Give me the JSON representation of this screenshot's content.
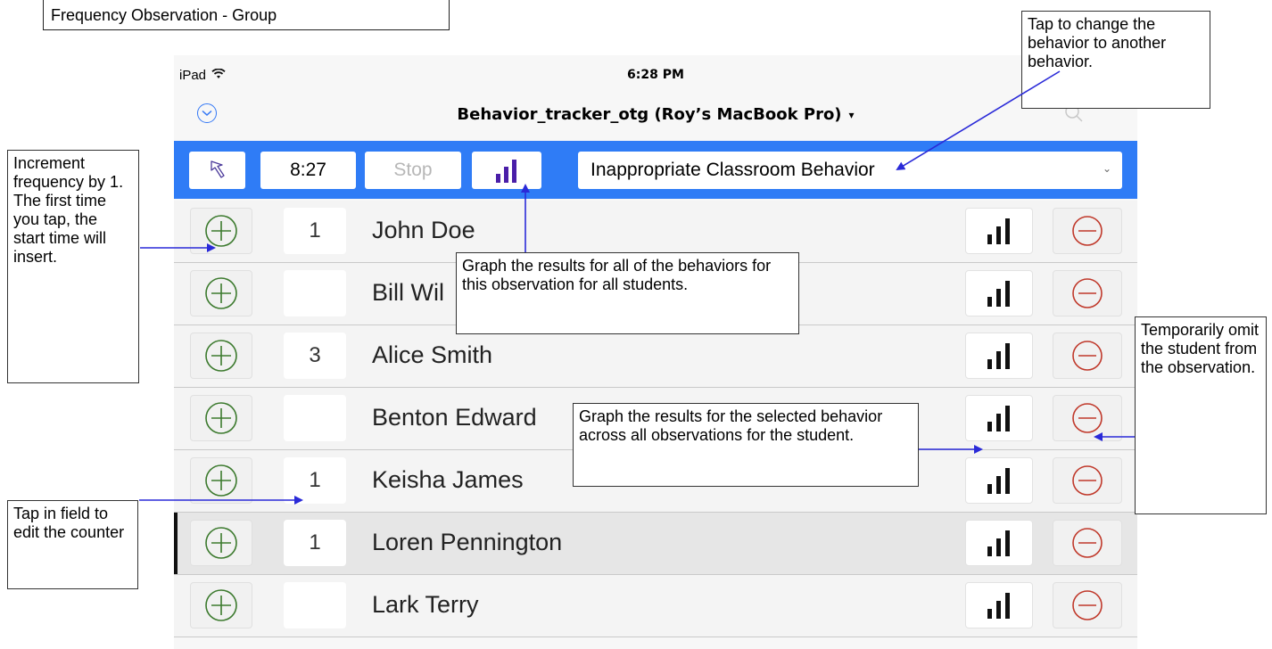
{
  "page_title": "Frequency Observation - Group",
  "status_bar": {
    "device": "iPad",
    "time": "6:28 PM"
  },
  "nav": {
    "title": "Behavior_tracker_otg (Roy’s MacBook Pro)",
    "caret": "▾"
  },
  "toolbar": {
    "timer": "8:27",
    "stop_label": "Stop",
    "behavior": "Inappropriate Classroom Behavior",
    "accent_color": "#2f7cf6"
  },
  "students": [
    {
      "name": "John Doe",
      "count": "1"
    },
    {
      "name": "Bill Wil",
      "count": ""
    },
    {
      "name": "Alice Smith",
      "count": "3"
    },
    {
      "name": "Benton Edward",
      "count": ""
    },
    {
      "name": "Keisha James",
      "count": "1"
    },
    {
      "name": "Loren Pennington",
      "count": "1"
    },
    {
      "name": "Lark Terry",
      "count": ""
    }
  ],
  "callouts": {
    "change_behavior": "Tap to change the behavior to another behavior.",
    "increment": "Increment frequency by 1. The first time you tap, the start time will insert.",
    "graph_all": "Graph the results for all of the behaviors for this observation for all students.",
    "graph_student": "Graph the results for the selected behavior across all observations for the student.",
    "omit": "Temporarily omit the student from the observation.",
    "edit_counter": "Tap in field to edit the counter"
  },
  "icons": {
    "plus": "plus-circle-icon",
    "minus": "minus-circle-icon",
    "graph": "bar-graph-icon",
    "back": "back-arrow-icon",
    "wifi": "wifi-icon",
    "search": "search-icon"
  }
}
